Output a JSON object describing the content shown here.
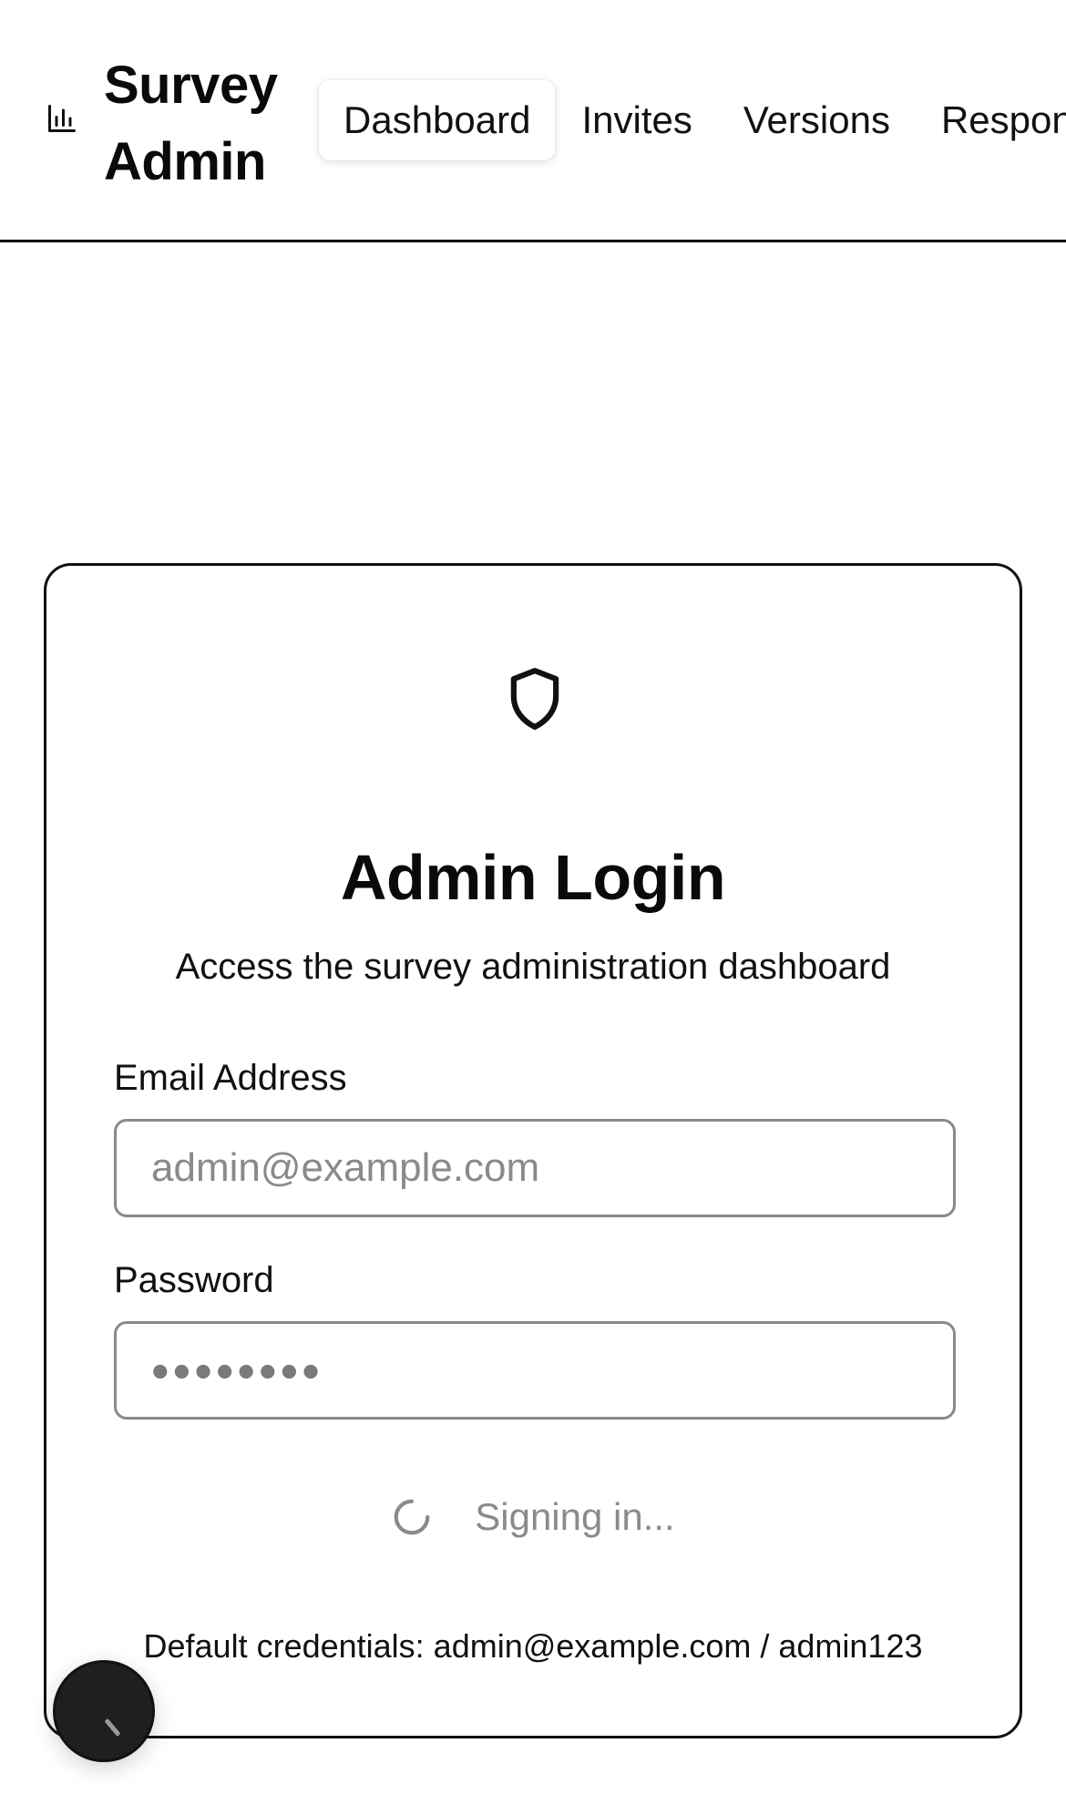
{
  "header": {
    "brand_icon": "bar-chart-icon",
    "brand_title": "Survey Admin",
    "nav": [
      {
        "label": "Dashboard",
        "active": true
      },
      {
        "label": "Invites",
        "active": false
      },
      {
        "label": "Versions",
        "active": false
      },
      {
        "label": "Responses",
        "active": false
      }
    ]
  },
  "login": {
    "icon": "shield-icon",
    "title": "Admin Login",
    "subtitle": "Access the survey administration dashboard",
    "email_label": "Email Address",
    "email_placeholder": "admin@example.com",
    "password_label": "Password",
    "password_value": "••••••••",
    "status_text": "Signing in...",
    "status_icon": "loading-spinner-icon",
    "credentials_hint": "Default credentials: admin@example.com / admin123"
  },
  "floating_button": {
    "icon": "dev-tools-icon"
  }
}
